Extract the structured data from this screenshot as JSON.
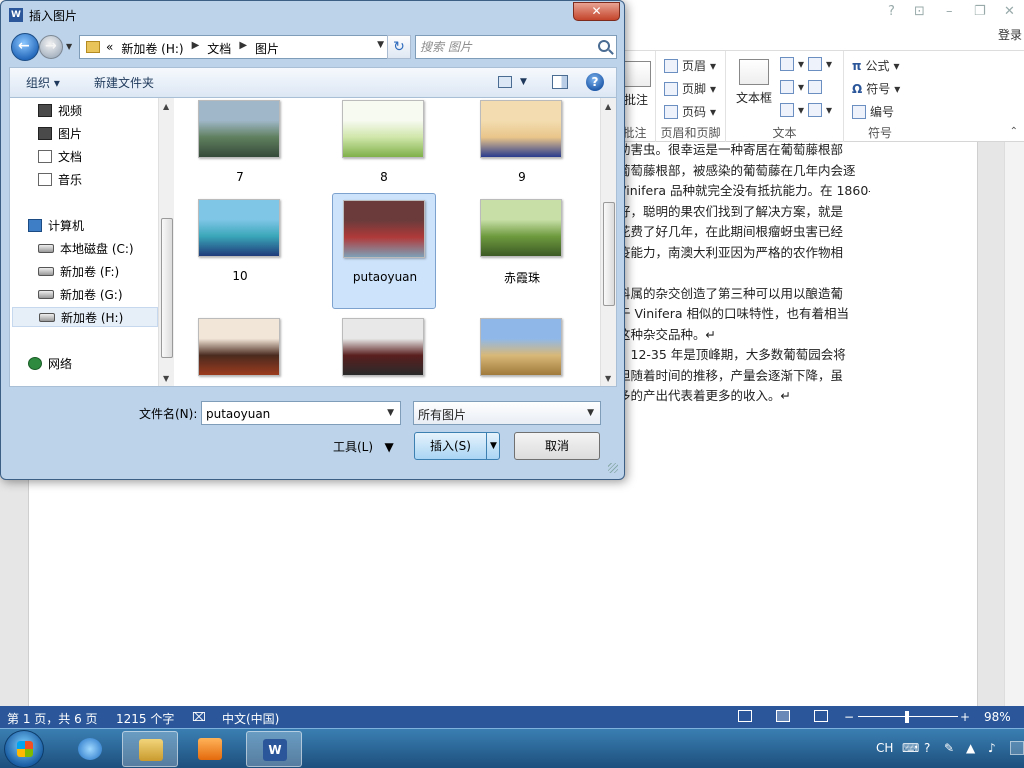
{
  "word": {
    "sign_in": "登录",
    "window_controls": [
      "?",
      "⊡",
      "–",
      "❐",
      "✕"
    ],
    "ribbon": {
      "groups": [
        {
          "label": "批注",
          "big": "批注"
        },
        {
          "label": "页眉和页脚",
          "items": [
            "页眉",
            "页脚",
            "页码"
          ]
        },
        {
          "label": "文本",
          "big": "文本框"
        },
        {
          "label": "符号",
          "items": [
            "公式",
            "符号",
            "编号"
          ]
        }
      ]
    },
    "doc_lines": [
      "助害虫。很幸运是一种寄居在葡萄藤根部",
      "葡萄藤根部，被感染的葡萄藤在几年内会逐",
      "Vinifera 品种就完全没有抵抗能力。在 1860-",
      "好，聪明的果农们找到了解决方案，就是",
      "花费了好几年，在此期间根瘤蚜虫害已经",
      "疫能力，南澳大利亚因为严格的农作物相",
      "",
      "科属的杂交创造了第三种可以用以酿造葡",
      "于 Vinifera 相似的口味特性，也有着相当",
      "这种杂交品种。↵",
      "，12-35 年是顶峰期，大多数葡萄园会将",
      "但随着时间的推移，产量会逐渐下降，虽",
      "多的产出代表着更多的收入。↵"
    ]
  },
  "status": {
    "page": "第 1 页，共 6 页",
    "words": "1215 个字",
    "language": "中文(中国)",
    "zoom": "98%",
    "zoom_level": 0.49
  },
  "taskbar": {
    "tray": {
      "lang": "CH"
    }
  },
  "dialog": {
    "title": "插入图片",
    "close": "✕",
    "breadcrumb": [
      "«",
      "新加卷 (H:)",
      "文档",
      "图片"
    ],
    "search_placeholder": "搜索 图片",
    "toolbar": {
      "organize": "组织 ▾",
      "new_folder": "新建文件夹",
      "help": "?"
    },
    "nav_items": [
      {
        "label": "视频",
        "icon": "video-icon",
        "type": "folder"
      },
      {
        "label": "图片",
        "icon": "pictures-icon",
        "type": "folder"
      },
      {
        "label": "文档",
        "icon": "documents-icon",
        "type": "doc"
      },
      {
        "label": "音乐",
        "icon": "music-icon",
        "type": "music"
      },
      {
        "label": "计算机",
        "icon": "computer-icon",
        "type": "pc"
      },
      {
        "label": "本地磁盘 (C:)",
        "icon": "drive-icon",
        "type": "drive"
      },
      {
        "label": "新加卷 (F:)",
        "icon": "drive-icon",
        "type": "drive"
      },
      {
        "label": "新加卷 (G:)",
        "icon": "drive-icon",
        "type": "drive"
      },
      {
        "label": "新加卷 (H:)",
        "icon": "drive-icon",
        "type": "drive",
        "selected": true
      },
      {
        "label": "网络",
        "icon": "network-icon",
        "type": "net"
      }
    ],
    "files": [
      {
        "label": "7",
        "colors": [
          "#9fb7c8",
          "#5f7f5e",
          "#354a3a"
        ]
      },
      {
        "label": "8",
        "colors": [
          "#f6faf0",
          "#cfe6a9",
          "#7fb04a"
        ]
      },
      {
        "label": "9",
        "colors": [
          "#f3ddb0",
          "#e9c58a",
          "#2a3b8f"
        ]
      },
      {
        "label": "10",
        "colors": [
          "#7fc6e6",
          "#3aa6b8",
          "#1f3b7a"
        ]
      },
      {
        "label": "putaoyuan",
        "colors": [
          "#6b3b3b",
          "#b03a3a",
          "#7da0b7"
        ],
        "selected": true
      },
      {
        "label": "赤霞珠",
        "colors": [
          "#c8e0a8",
          "#6e9a3e",
          "#3c5a25"
        ]
      },
      {
        "label": "",
        "colors": [
          "#f2e6d8",
          "#4a2a1e",
          "#9c3b1e"
        ]
      },
      {
        "label": "",
        "colors": [
          "#e8e8e8",
          "#5a1e1e",
          "#2a2a2a"
        ]
      },
      {
        "label": "",
        "colors": [
          "#8fb8e8",
          "#d8b878",
          "#a07a3a"
        ]
      }
    ],
    "filename_label": "文件名(N):",
    "filename_value": "putaoyuan",
    "filetype": "所有图片",
    "tools": "工具(L)",
    "insert": "插入(S)",
    "cancel": "取消"
  }
}
